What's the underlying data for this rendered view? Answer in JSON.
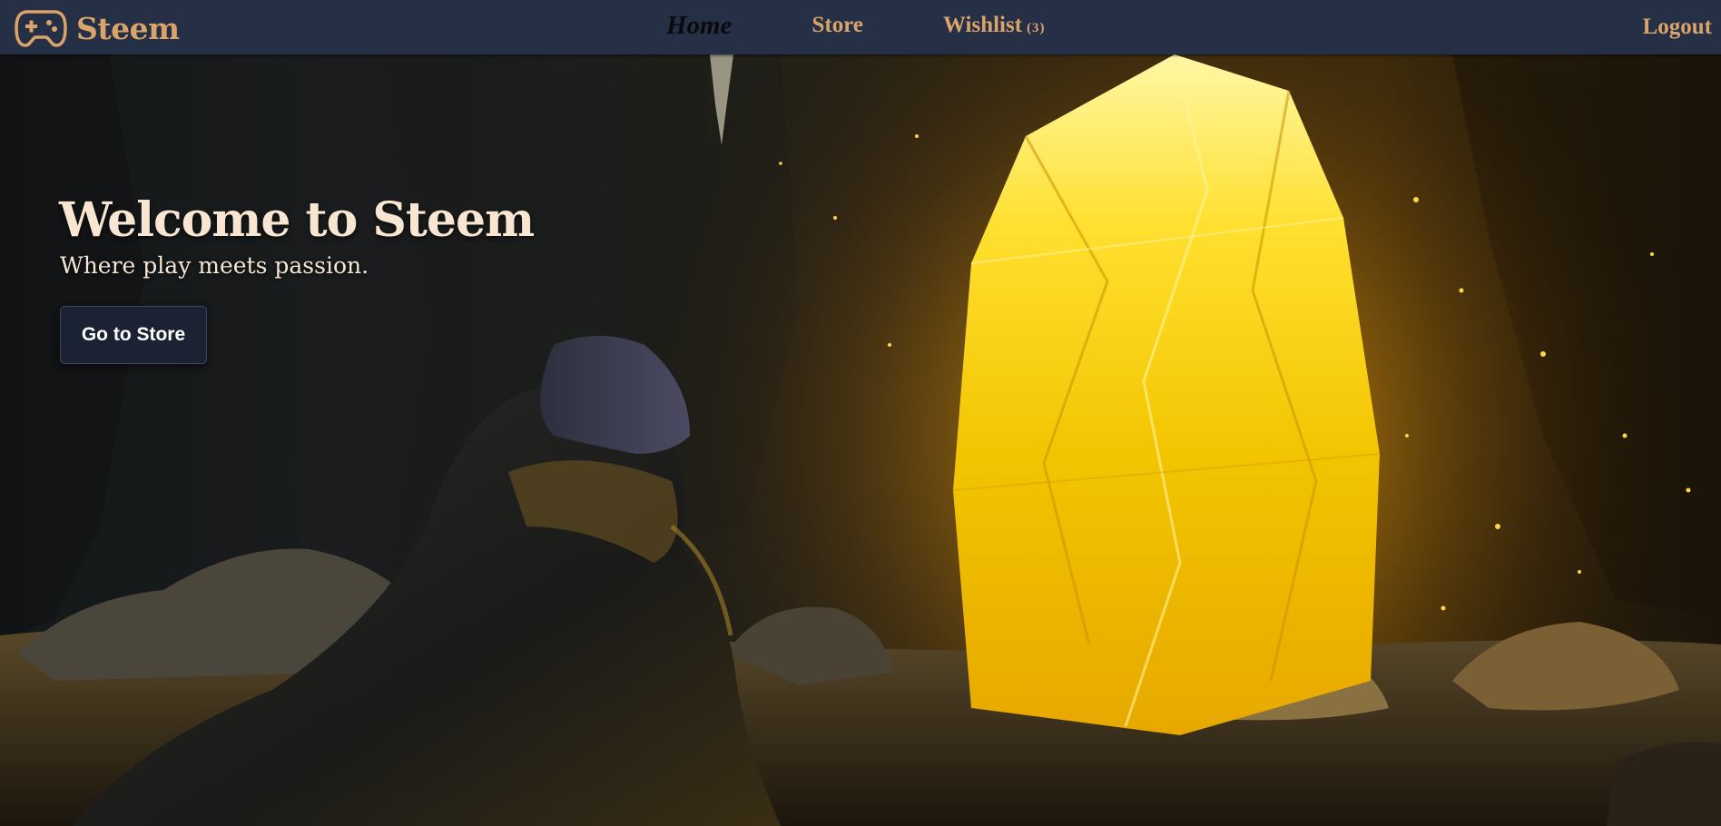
{
  "nav": {
    "brand": {
      "name": "Steem",
      "icon": "gamepad-icon"
    },
    "links": [
      {
        "label": "Home",
        "active": true
      },
      {
        "label": "Store",
        "active": false
      },
      {
        "label": "Wishlist",
        "active": false,
        "count": "(3)"
      }
    ],
    "logout_label": "Logout"
  },
  "hero": {
    "title": "Welcome to Steem",
    "subtitle": "Where play meets passion.",
    "cta_label": "Go to Store",
    "image": "hooded-figure-kneeling-before-glowing-yellow-crystal-in-cave"
  },
  "colors": {
    "nav_background": "#252f46",
    "accent": "#d9a36a",
    "active_link": "#0a0a0a",
    "button_background": "#1b2233",
    "hero_text": "#f8e6d3"
  }
}
